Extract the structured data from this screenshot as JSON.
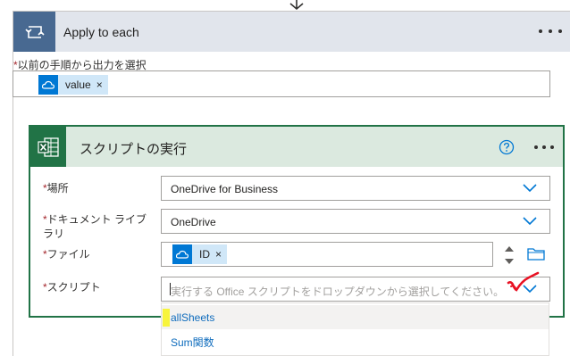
{
  "apply_each": {
    "title": "Apply to each",
    "prev_output_label": "以前の手順から出力を選択",
    "token_value": "value",
    "token_remove": "×",
    "colors": {
      "header_bg": "#e1e5ec",
      "icon_bg": "#486991"
    }
  },
  "script_action": {
    "title": "スクリプトの実行",
    "colors": {
      "accent": "#217346",
      "header_bg": "#dbe9df",
      "link": "#0f6cbd",
      "required": "#a4262c"
    },
    "fields": {
      "location": {
        "label": "場所",
        "value": "OneDrive for Business"
      },
      "library": {
        "label_line1": "ドキュメント ライブ",
        "label_line2": "ラリ",
        "value": "OneDrive"
      },
      "file": {
        "label": "ファイル",
        "token": "ID",
        "token_remove": "×"
      },
      "script": {
        "label": "スクリプト",
        "placeholder": "実行する Office スクリプトをドロップダウンから選択してください。"
      }
    },
    "dropdown_options": [
      "allSheets",
      "Sum関数"
    ],
    "selected_option": "allSheets"
  },
  "required_marker": "*"
}
